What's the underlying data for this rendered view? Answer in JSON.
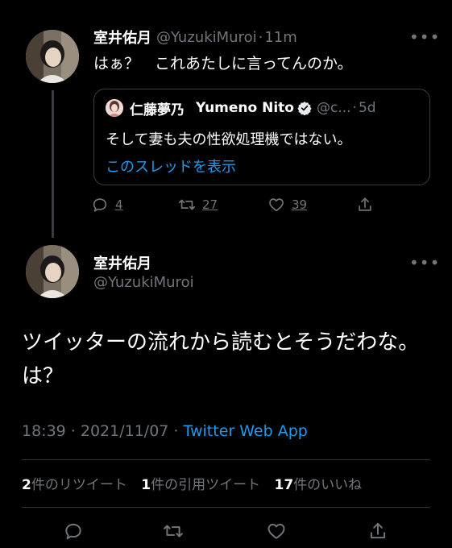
{
  "reply_tweet": {
    "author_name": "室井佑月",
    "handle": "@YuzukiMuroi",
    "separator": "·",
    "time": "11m",
    "more": "•••",
    "text": "はぁ？　これあたしに言ってんのか。",
    "quoted": {
      "author_name_jp": "仁藤夢乃",
      "author_name_en": "Yumeno Nito",
      "handle": "@c...",
      "separator": "·",
      "time": "5d",
      "text": "そして妻も夫の性欲処理機ではない。",
      "show_thread": "このスレッドを表示"
    },
    "actions": {
      "replies": "4",
      "retweets": "27",
      "likes": "39"
    }
  },
  "main_tweet": {
    "author_name": "室井佑月",
    "handle": "@YuzukiMuroi",
    "more": "•••",
    "text": "ツイッターの流れから読むとそうだわな。は？",
    "timestamp": "18:39 · 2021/11/07 · ",
    "source": "Twitter Web App",
    "stats": {
      "retweets_count": "2",
      "retweets_label": "件のリツイート",
      "quotes_count": "1",
      "quotes_label": "件の引用ツイート",
      "likes_count": "17",
      "likes_label": "件のいいね"
    }
  },
  "colors": {
    "background": "#000000",
    "text": "#ffffff",
    "muted": "#71767b",
    "link": "#1d9bf0",
    "border": "#2f3336"
  }
}
